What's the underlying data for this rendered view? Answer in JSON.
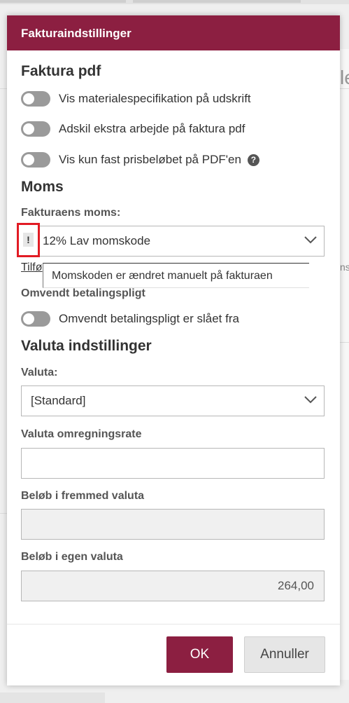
{
  "modal": {
    "title": "Fakturaindstillinger"
  },
  "pdf_section": {
    "title": "Faktura pdf",
    "toggles": [
      {
        "label": "Vis materialespecifikation på udskrift",
        "on": false
      },
      {
        "label": "Adskil ekstra arbejde på faktura pdf",
        "on": false
      },
      {
        "label": "Vis kun fast prisbeløbet på PDF'en",
        "on": false,
        "help": "?"
      }
    ]
  },
  "vat_section": {
    "title": "Moms",
    "vat_label": "Fakturaens moms:",
    "vat_value": "12% Lav momskode",
    "warning_mark": "!",
    "tooltip": "Momskoden er ændret manuelt på fakturaen",
    "link_partial": "Tilfø",
    "reverse_label": "Omvendt betalingspligt",
    "reverse_toggle": {
      "label": "Omvendt betalingspligt er slået fra",
      "on": false
    }
  },
  "currency_section": {
    "title": "Valuta indstillinger",
    "currency_label": "Valuta:",
    "currency_value": "[Standard]",
    "rate_label": "Valuta omregningsrate",
    "rate_value": "",
    "foreign_label": "Beløb i fremmed valuta",
    "foreign_value": "",
    "own_label": "Beløb i egen valuta",
    "own_value": "264,00"
  },
  "footer": {
    "ok_label": "OK",
    "cancel_label": "Annuller"
  },
  "background": {
    "right_fragment": "le",
    "right_fragment2": "ns"
  },
  "colors": {
    "brand": "#8c1f41",
    "warning_border": "#e21b24",
    "toggle_off": "#9a9a9a"
  }
}
